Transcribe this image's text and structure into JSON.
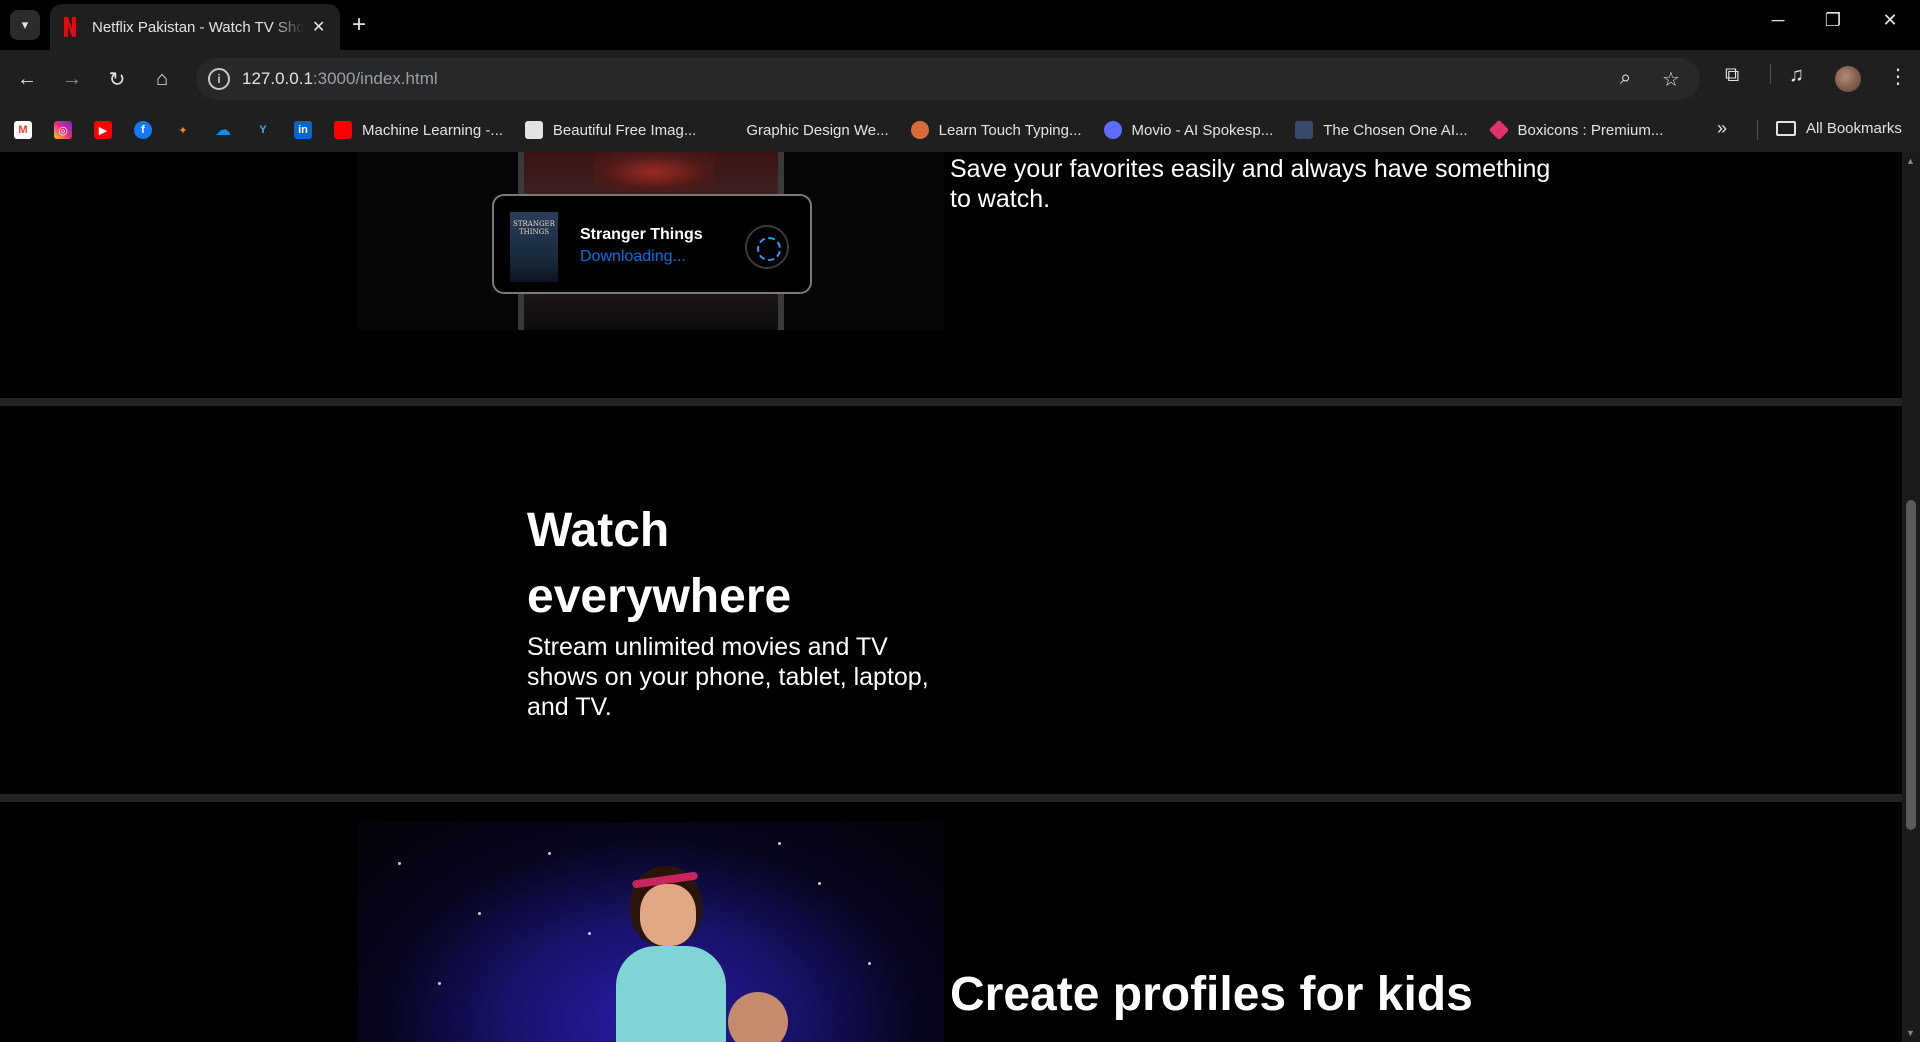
{
  "browser": {
    "tab_title": "Netflix Pakistan - Watch TV Shows Online, Watch Movies Online",
    "url_host": "127.0.0.1",
    "url_rest": ":3000/index.html",
    "bookmarks": [
      {
        "label": "Machine Learning -...",
        "icon": "youtube-icon",
        "color": "#ff0000"
      },
      {
        "label": "Beautiful Free Imag...",
        "icon": "unsplash-icon",
        "color": "#e3e3e3"
      },
      {
        "label": "Graphic Design We...",
        "icon": "design-icon",
        "color": "#1f1f1f"
      },
      {
        "label": "Learn Touch Typing...",
        "icon": "typing-icon",
        "color": "#d86b3a"
      },
      {
        "label": "Movio - AI Spokesp...",
        "icon": "movio-icon",
        "color": "#5b6cff"
      },
      {
        "label": "The Chosen One AI...",
        "icon": "chosen-icon",
        "color": "#3a4a6a"
      },
      {
        "label": "Boxicons : Premium...",
        "icon": "boxicons-icon",
        "color": "#e0336e"
      }
    ],
    "all_bookmarks_label": "All Bookmarks"
  },
  "features": {
    "save_text": "Save your favorites easily and always have something to watch.",
    "download_card": {
      "title": "Stranger Things",
      "status": "Downloading...",
      "poster_text": "STRANGER THINGS"
    },
    "watch_heading": "Watch everywhere",
    "watch_text": "Stream unlimited movies and TV shows on your phone, tablet, laptop, and TV.",
    "kids_heading": "Create profiles for kids"
  }
}
